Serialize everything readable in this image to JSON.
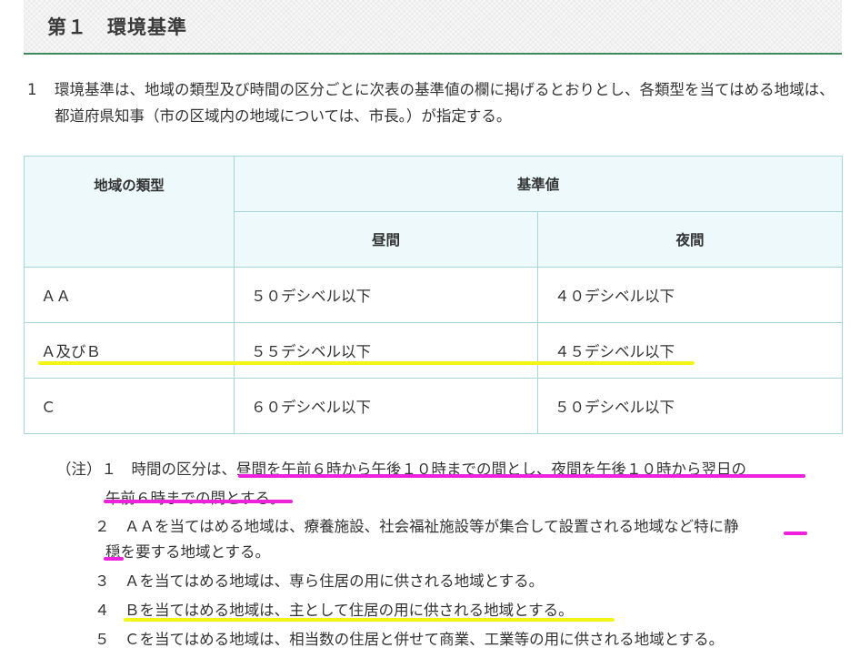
{
  "section": {
    "title": "第１　環境基準"
  },
  "intro": {
    "number": "1",
    "text": "環境基準は、地域の類型及び時間の区分ごとに次表の基準値の欄に掲げるとおりとし、各類型を当てはめる地域は、都道府県知事（市の区域内の地域については、市長。）が指定する。"
  },
  "table": {
    "head_type": "地域の類型",
    "head_standard": "基準値",
    "head_day": "昼間",
    "head_night": "夜間",
    "rows": [
      {
        "type": "ＡＡ",
        "day": "５０デシベル以下",
        "night": "４０デシベル以下"
      },
      {
        "type": "Ａ及びＢ",
        "day": "５５デシベル以下",
        "night": "４５デシベル以下"
      },
      {
        "type": "Ｃ",
        "day": "６０デシベル以下",
        "night": "５０デシベル以下"
      }
    ]
  },
  "notes": {
    "prefix": "（注）１",
    "n1_a": "時間の区分は、",
    "n1_b": "昼間を午前６時から午後１０時までの間とし、夜間を午後１０時から翌日の",
    "n1_c": "午前６時までの間とする。",
    "n2_num": "２",
    "n2_a": "ＡＡを当てはめる地域は、療養施設、社会福祉施設等が集合して設置される地域など特に静",
    "n2_b": "穏を要する地域とする。",
    "n3_num": "３",
    "n3": "Ａを当てはめる地域は、専ら住居の用に供される地域とする。",
    "n4_num": "４",
    "n4": "Ｂを当てはめる地域は、主として住居の用に供される地域とする。",
    "n5_num": "５",
    "n5": "Ｃを当てはめる地域は、相当数の住居と併せて商業、工業等の用に供される地域とする。"
  },
  "colors": {
    "accent_line": "#3f8a5b",
    "table_header": "#edf9fb",
    "table_border": "#a8d5d5",
    "highlight_yellow": "#f5f515",
    "highlight_magenta": "#ee22dd"
  }
}
